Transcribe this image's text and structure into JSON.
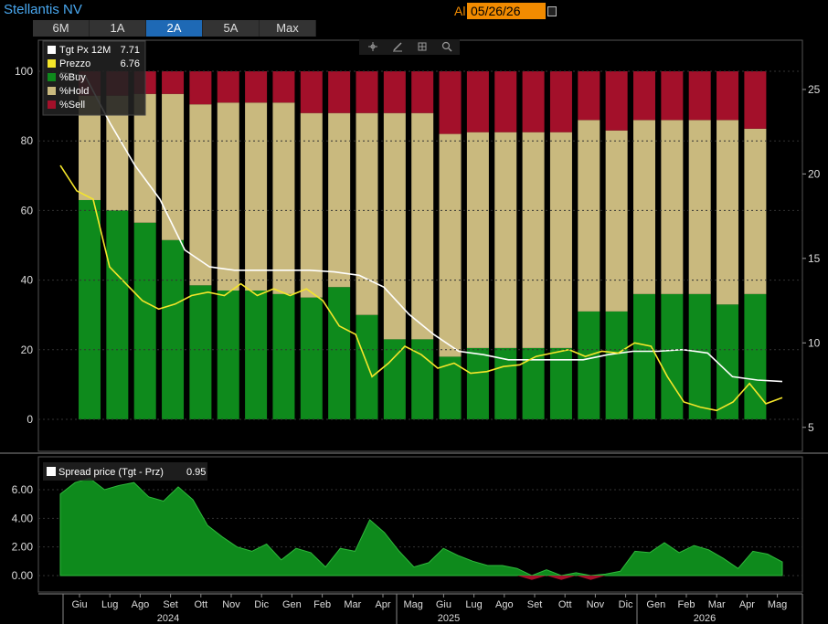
{
  "header": {
    "title": "Stellantis NV",
    "date_prefix": "Al",
    "date_value": "05/26/26",
    "tabs": [
      {
        "label": "6M",
        "active": false
      },
      {
        "label": "1A",
        "active": false
      },
      {
        "label": "2A",
        "active": true
      },
      {
        "label": "5A",
        "active": false
      },
      {
        "label": "Max",
        "active": false
      }
    ]
  },
  "icons": [
    "crosshair-icon",
    "pencil-icon",
    "table-icon",
    "zoom-icon"
  ],
  "legend_top": [
    {
      "label": "Tgt Px 12M",
      "value": "7.71",
      "color": "#ffffff"
    },
    {
      "label": "Prezzo",
      "value": "6.76",
      "color": "#f5e62a"
    },
    {
      "label": "%Buy",
      "value": "",
      "color": "#0e8a1c"
    },
    {
      "label": "%Hold",
      "value": "",
      "color": "#c9b97e"
    },
    {
      "label": "%Sell",
      "value": "",
      "color": "#a3102a"
    }
  ],
  "legend_bottom": {
    "label": "Spread price (Tgt - Prz)",
    "value": "0.95",
    "color": "#ffffff"
  },
  "x_axis": {
    "months": [
      "Giu",
      "Lug",
      "Ago",
      "Set",
      "Ott",
      "Nov",
      "Dic",
      "Gen",
      "Feb",
      "Mar",
      "Apr",
      "Mag",
      "Giu",
      "Lug",
      "Ago",
      "Set",
      "Ott",
      "Nov",
      "Dic",
      "Gen",
      "Feb",
      "Mar",
      "Apr",
      "Mag"
    ],
    "years": [
      "2024",
      "2025",
      "2026"
    ]
  },
  "chart_data": [
    {
      "type": "bar",
      "stacked": true,
      "left_axis": {
        "ticks": [
          "0",
          "20",
          "40",
          "60",
          "80",
          "100"
        ],
        "range": [
          0,
          100
        ]
      },
      "right_axis": {
        "ticks": [
          "5",
          "10",
          "15",
          "20",
          "25"
        ],
        "range": [
          4.5,
          27.7
        ]
      },
      "series": [
        {
          "name": "%Buy",
          "values": [
            63,
            60,
            56.5,
            51.5,
            38.5,
            37,
            37,
            36,
            35,
            38,
            30,
            23,
            23,
            18,
            20.5,
            20.5,
            20.5,
            20.5,
            31,
            31,
            36,
            36,
            36,
            33,
            36
          ]
        },
        {
          "name": "%Hold",
          "values": [
            30,
            33,
            37,
            42,
            52,
            54,
            54,
            55,
            53,
            50,
            58,
            65,
            65,
            64,
            62,
            62,
            62,
            62,
            55,
            52,
            50,
            50,
            50,
            53,
            47.5
          ]
        },
        {
          "name": "%Sell",
          "values": [
            7,
            7,
            6.5,
            6.5,
            9.5,
            9,
            9,
            9,
            12,
            12,
            12,
            12,
            12,
            18,
            17.5,
            17.5,
            17.5,
            17.5,
            14,
            17,
            14,
            14,
            14,
            14,
            16.5
          ]
        }
      ],
      "lines": [
        {
          "name": "Tgt Px 12M",
          "axis": "right",
          "values": [
            26,
            25.8,
            23,
            20.5,
            18.5,
            15.5,
            14.5,
            14.3,
            14.3,
            14.3,
            14.3,
            14.2,
            14,
            13.3,
            11.7,
            10.5,
            9.5,
            9.3,
            9,
            9,
            9,
            9,
            9.3,
            9.5,
            9.5,
            9.6,
            9.4,
            8,
            7.8,
            7.71
          ]
        },
        {
          "name": "Prezzo",
          "axis": "right",
          "values": [
            20.5,
            19,
            18.5,
            14.5,
            13.5,
            12.5,
            12,
            12.3,
            12.8,
            13,
            12.8,
            13.5,
            12.8,
            13.2,
            12.8,
            13.2,
            12.5,
            11,
            10.5,
            8,
            8.8,
            9.8,
            9.3,
            8.5,
            8.8,
            8.2,
            8.3,
            8.6,
            8.7,
            9.2,
            9.4,
            9.6,
            9.2,
            9.5,
            9.4,
            10,
            9.8,
            8,
            6.5,
            6.2,
            6,
            6.5,
            7.6,
            6.4,
            6.76
          ]
        }
      ]
    },
    {
      "type": "area",
      "y_axis": {
        "ticks": [
          "0.00",
          "2.00",
          "4.00",
          "6.00"
        ],
        "range": [
          -0.8,
          7.3
        ]
      },
      "series": [
        {
          "name": "Spread price (Tgt - Prz)",
          "values": [
            5.7,
            6.5,
            6.8,
            6,
            6.3,
            6.5,
            5.5,
            5.2,
            6.2,
            5.3,
            3.5,
            2.7,
            2,
            1.7,
            2.2,
            1.1,
            1.9,
            1.6,
            0.6,
            1.9,
            1.7,
            3.9,
            3,
            1.7,
            0.6,
            0.9,
            1.9,
            1.4,
            1,
            0.7,
            0.7,
            0.5,
            -0.3,
            0.4,
            -0.3,
            0.2,
            -0.3,
            0.1,
            0.3,
            1.7,
            1.6,
            2.3,
            1.6,
            2.1,
            1.8,
            1.2,
            0.5,
            1.7,
            1.5,
            0.95
          ]
        }
      ]
    }
  ]
}
